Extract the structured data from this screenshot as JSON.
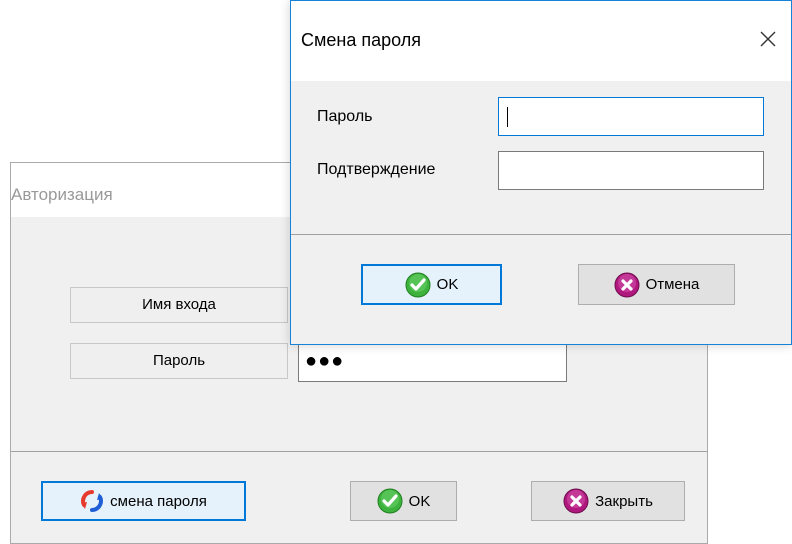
{
  "auth_window": {
    "title": "Авторизация",
    "login_label": "Имя входа",
    "password_label": "Пароль",
    "password_value": "●●●",
    "change_password_button": "смена пароля",
    "ok_button": "OK",
    "close_button": "Закрыть"
  },
  "change_password_dialog": {
    "title": "Смена пароля",
    "password_label": "Пароль",
    "password_value": "",
    "confirm_label": "Подтверждение",
    "confirm_value": "",
    "ok_button": "OK",
    "cancel_button": "Отмена"
  },
  "icons": {
    "close": "close-icon",
    "ok": "green-checkmark-icon",
    "cancel": "magenta-x-circle-icon",
    "refresh": "refresh-arrows-icon"
  },
  "colors": {
    "accent": "#0078d7",
    "ok_green": "#3db33d",
    "cancel_magenta": "#b0187e",
    "refresh_red": "#e63a2e",
    "refresh_blue": "#1f5fd6"
  }
}
